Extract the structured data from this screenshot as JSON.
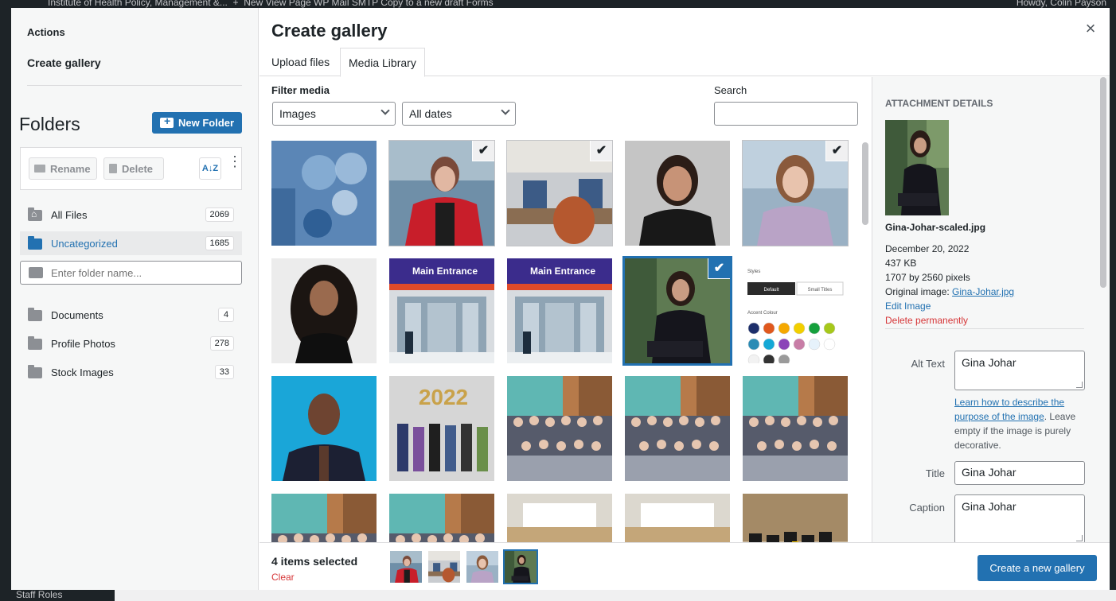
{
  "adminbar": {
    "left_text": "Institute of Health Policy, Management &...    +   New   View Page   WP Mail SMTP   Copy to a new draft   Forms",
    "right_text": "Howdy, Colin Payson"
  },
  "wp_menu_item": "Staff Roles",
  "menu": {
    "actions": "Actions",
    "create_gallery": "Create gallery",
    "folders_title": "Folders",
    "new_folder": "New Folder",
    "rename": "Rename",
    "delete": "Delete",
    "sort_label": "A↓Z",
    "folder_input_placeholder": "Enter folder name...",
    "system_folders": [
      {
        "name": "All Files",
        "count": "2069"
      },
      {
        "name": "Uncategorized",
        "count": "1685"
      }
    ],
    "folders": [
      {
        "name": "Documents",
        "count": "4"
      },
      {
        "name": "Profile Photos",
        "count": "278"
      },
      {
        "name": "Stock Images",
        "count": "33"
      }
    ]
  },
  "frame": {
    "title": "Create gallery",
    "close": "×",
    "tabs": [
      "Upload files",
      "Media Library"
    ]
  },
  "filters": {
    "label": "Filter media",
    "type_value": "Images",
    "date_value": "All dates",
    "search_label": "Search"
  },
  "attachments": [
    {
      "kind": "tech",
      "selected": false
    },
    {
      "kind": "woman-red",
      "selected": true
    },
    {
      "kind": "meeting",
      "selected": true
    },
    {
      "kind": "woman-dark",
      "selected": false
    },
    {
      "kind": "woman-lavender",
      "selected": true
    },
    {
      "kind": "woman-curly",
      "selected": false
    },
    {
      "kind": "entrance",
      "selected": false
    },
    {
      "kind": "entrance",
      "selected": false
    },
    {
      "kind": "gina",
      "selected": true,
      "focused": true
    },
    {
      "kind": "styles-panel",
      "selected": false
    },
    {
      "kind": "man-blue",
      "selected": false
    },
    {
      "kind": "group-2022",
      "selected": false
    },
    {
      "kind": "group",
      "selected": false
    },
    {
      "kind": "group",
      "selected": false
    },
    {
      "kind": "group",
      "selected": false
    },
    {
      "kind": "group",
      "selected": false
    },
    {
      "kind": "group",
      "selected": false
    },
    {
      "kind": "room",
      "selected": false
    },
    {
      "kind": "room",
      "selected": false
    },
    {
      "kind": "grads",
      "selected": false
    }
  ],
  "styles_panel": {
    "styles": "Styles",
    "default": "Default",
    "small_titles": "Small Titles",
    "accent": "Accent Colour"
  },
  "entrance_sign": "Main Entrance",
  "year_balloons": "2022",
  "details": {
    "heading": "Attachment Details",
    "filename": "Gina-Johar-scaled.jpg",
    "date": "December 20, 2022",
    "size": "437 KB",
    "dimensions": "1707 by 2560 pixels",
    "original_label": "Original image:",
    "original_link": "Gina-Johar.jpg",
    "edit": "Edit Image",
    "delete": "Delete permanently",
    "alt_label": "Alt Text",
    "alt_value": "Gina Johar",
    "alt_help_link": "Learn how to describe the purpose of the image",
    "alt_help_rest": ". Leave empty if the image is purely decorative.",
    "title_label": "Title",
    "title_value": "Gina Johar",
    "caption_label": "Caption",
    "caption_value": "Gina Johar"
  },
  "toolbar": {
    "count": "4 items selected",
    "clear": "Clear",
    "create": "Create a new gallery"
  },
  "colors": {
    "accent": "#2271b1",
    "danger": "#d63638"
  }
}
